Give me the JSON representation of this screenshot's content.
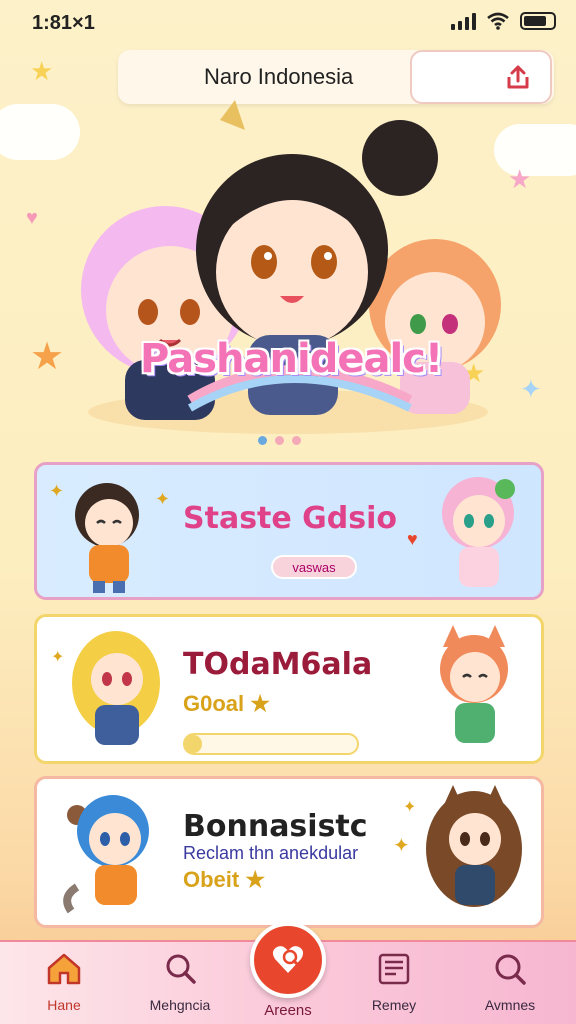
{
  "status_bar": {
    "time": "1:81×1"
  },
  "header": {
    "title": "Naro Indonesia"
  },
  "hero": {
    "banner_text": "Pashanidealc!",
    "carousel_dots": 3,
    "active_dot": 1
  },
  "cards": [
    {
      "title": "Staste Gdsio",
      "chip": "vaswas"
    },
    {
      "title": "TOdaM6ala",
      "subtitle": "G0oal ★",
      "progress": 0.1
    },
    {
      "title": "Bonnasistc",
      "subtitle": "Reclam thn anekdular",
      "subtitle2": "Obeit ★"
    }
  ],
  "nav": {
    "items": [
      {
        "label": "Hane",
        "icon": "home-icon"
      },
      {
        "label": "Mehgncia",
        "icon": "search-icon"
      },
      {
        "label": "Areens",
        "icon": "heart-search-icon"
      },
      {
        "label": "Remey",
        "icon": "news-icon"
      },
      {
        "label": "Avmnes",
        "icon": "magnifier-icon"
      }
    ]
  },
  "colors": {
    "accent_red": "#e8472d",
    "pink": "#f472b6",
    "card_title_pink": "#e0428a",
    "card_title_red": "#9b1b3a",
    "gold": "#d9a21b"
  }
}
